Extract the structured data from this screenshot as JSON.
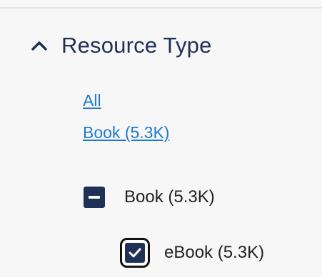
{
  "facet": {
    "title": "Resource Type",
    "expanded_icon": "chevron-up-icon"
  },
  "links": {
    "all": "All",
    "book": "Book (5.3K)"
  },
  "filters": {
    "parent": {
      "label": "Book (5.3K)",
      "state": "partial"
    },
    "child": {
      "label": "eBook (5.3K)",
      "state": "checked"
    }
  },
  "colors": {
    "navy": "#1f3157",
    "link": "#1f7ad1",
    "background": "#f7f7f7"
  }
}
